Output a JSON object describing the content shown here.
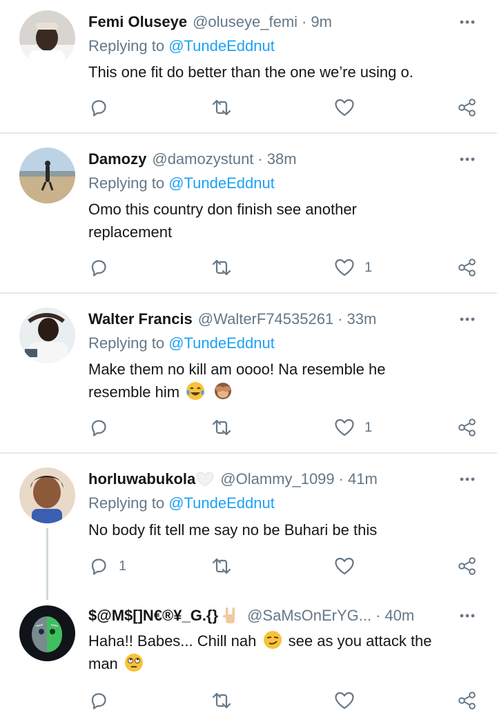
{
  "tweets": [
    {
      "name": "Femi Oluseye",
      "handle": "@oluseye_femi",
      "dot": "·",
      "time": "9m",
      "replying_prefix": "Replying to",
      "replying_to": "@TundeEddnut",
      "text": "This one fit do better than the one we’re using o.",
      "replies": "",
      "retweets": "",
      "likes": ""
    },
    {
      "name": "Damozy",
      "handle": "@damozystunt",
      "dot": "·",
      "time": "38m",
      "replying_prefix": "Replying to",
      "replying_to": "@TundeEddnut",
      "text_line1": "Omo this country don finish see another",
      "text_line2": "replacement",
      "likes": "1"
    },
    {
      "name": "Walter Francis",
      "handle": "@WalterF74535261",
      "dot": "·",
      "time": "33m",
      "replying_prefix": "Replying to",
      "replying_to": "@TundeEddnut",
      "text_line1": "Make them no kill am oooo! Na resemble he",
      "text_line2": "resemble him",
      "likes": "1"
    },
    {
      "name": "horluwabukola",
      "handle": "@Olammy_1099",
      "dot": "·",
      "time": "41m",
      "replying_prefix": "Replying to",
      "replying_to": "@TundeEddnut",
      "text": "No body fit tell me say no be Buhari be this",
      "replies": "1"
    },
    {
      "name": "$@M$[]N€®¥_G.{}",
      "handle": "@SaMsOnErYG...",
      "dot": "·",
      "time": "40m",
      "text_part1": "Haha!! Babes... Chill nah",
      "text_part2": "see as you attack the",
      "text_line2": "man"
    }
  ],
  "icons": {
    "reply": "reply-icon",
    "retweet": "retweet-icon",
    "like": "heart-icon",
    "share": "share-icon",
    "more": "more-icon"
  },
  "colors": {
    "accent": "#1da1f2",
    "secondary_text": "#657786",
    "icon": "#657786",
    "divider": "#e1e8ed"
  }
}
